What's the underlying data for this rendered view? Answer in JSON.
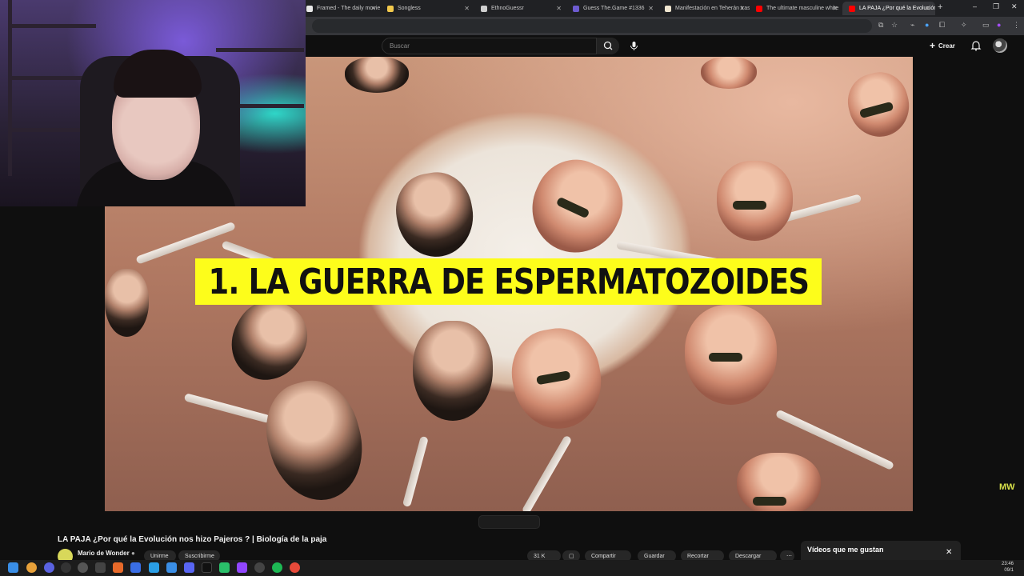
{
  "browser": {
    "tabs": [
      {
        "label": "Framed - The daily movie gu",
        "color": "#e8e8e8"
      },
      {
        "label": "Songless",
        "color": "#f2c94c"
      },
      {
        "label": "EthnoGuessr",
        "color": "#cfcfcf"
      },
      {
        "label": "Guess The.Game #1336",
        "color": "#6d5bd0"
      },
      {
        "label": "Manifestación en Teherán tras",
        "color": "#f0e6d0"
      },
      {
        "label": "The ultimate masculine white",
        "color": "#ff0000"
      },
      {
        "label": "LA PAJA ¿Por qué la Evolución",
        "color": "#ff0000",
        "active": true
      }
    ],
    "new_tab": "+",
    "window_controls": {
      "minimize": "–",
      "maximize": "❐",
      "close": "✕"
    }
  },
  "youtube": {
    "search_placeholder": "Buscar",
    "create_label": "Crear"
  },
  "video": {
    "overlay_title": "1. LA GUERRA DE ESPERMATOZOIDES",
    "watermark": "MW",
    "title": "LA PAJA ¿Por qué la Evolución nos hizo Pajeros ? | Biología de la paja",
    "channel": "Mario de Wonder",
    "join_label": "Unirme",
    "subscribe_label": "Suscribirme",
    "likes": "31 K",
    "share_label": "Compartir",
    "save_label": "Guardar",
    "clip_label": "Recortar",
    "thanks_label": "Descargar"
  },
  "sidebar": {
    "liked_title": "Vídeos que me gustan",
    "close": "✕"
  },
  "taskbar": {
    "time": "23:46",
    "date": "09/1"
  },
  "colors": {
    "accent_yellow": "#fdfd1b",
    "youtube_red": "#ff0000"
  }
}
